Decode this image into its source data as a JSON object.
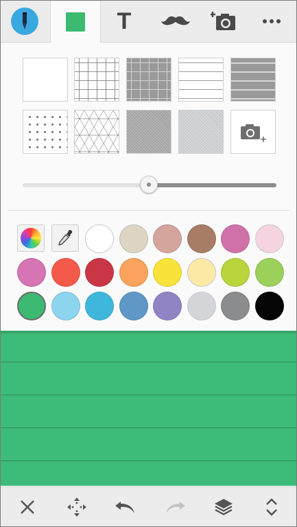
{
  "toolbar": {
    "tools": [
      {
        "name": "pen-tool",
        "icon": "pen-icon"
      },
      {
        "name": "paper-style",
        "icon": "paper-swatch-icon",
        "color": "#3cba72"
      },
      {
        "name": "text-tool",
        "icon": "text-icon",
        "label": "T"
      },
      {
        "name": "sticker-tool",
        "icon": "mustache-icon"
      },
      {
        "name": "add-photo",
        "icon": "camera-add-icon"
      },
      {
        "name": "more-menu",
        "icon": "more-icon"
      }
    ]
  },
  "paper_patterns": [
    "blank",
    "small-grid",
    "dark-grid",
    "lined",
    "dark-lined",
    "dots",
    "isometric",
    "gray-canvas",
    "light-canvas",
    "photo-background"
  ],
  "brightness": {
    "value": 0.5
  },
  "colors": [
    "#ffffff",
    "#ddd5c4",
    "#d4a59c",
    "#a77d65",
    "#d072a9",
    "#f6d3e1",
    "#d674b4",
    "#f45a4a",
    "#cb3646",
    "#f9a35c",
    "#f9e33a",
    "#fde9a6",
    "#b8d53c",
    "#9bd05a",
    "#3cba72",
    "#8dd4ef",
    "#3fb7dd",
    "#5f98c6",
    "#9283c5",
    "#d3d5d8",
    "#8b8c8d",
    "#050505"
  ],
  "selected_color": "#3cba72",
  "bottom": {
    "tools": [
      "close-icon",
      "move-icon",
      "undo-icon",
      "redo-icon",
      "layers-icon",
      "expand-icon"
    ]
  }
}
